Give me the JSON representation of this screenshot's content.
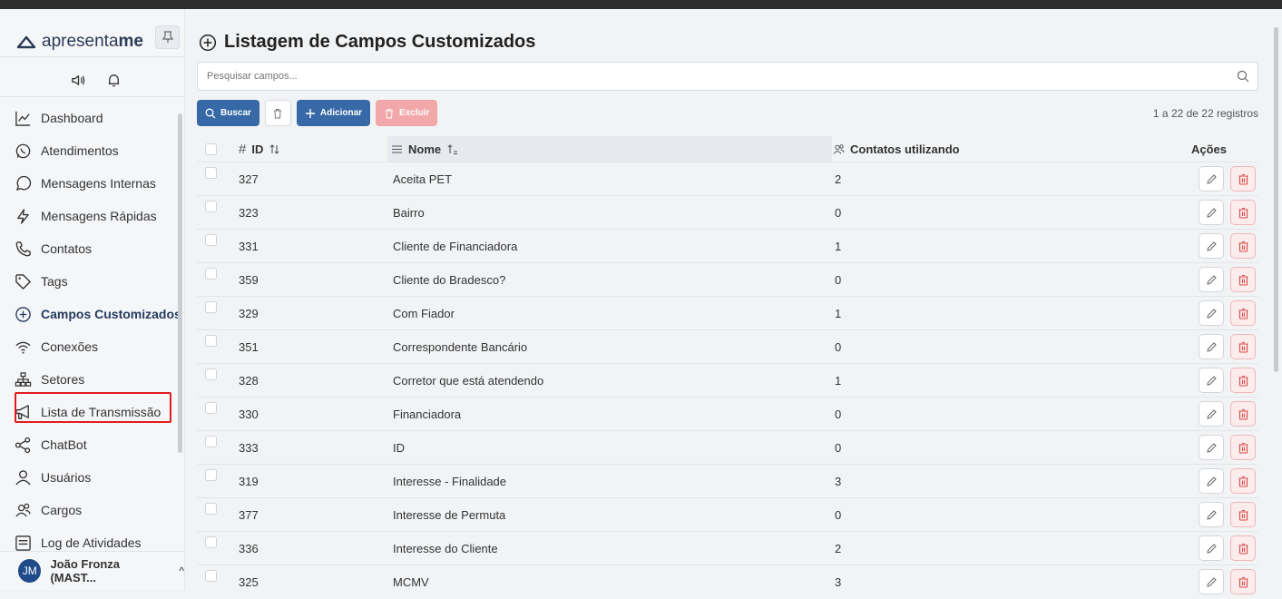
{
  "brand": {
    "name_light": "apresenta",
    "name_bold": "me"
  },
  "sidebar": {
    "items": [
      {
        "label": "Dashboard",
        "icon": "chart-line-icon"
      },
      {
        "label": "Atendimentos",
        "icon": "whatsapp-icon"
      },
      {
        "label": "Mensagens Internas",
        "icon": "chat-bubble-icon"
      },
      {
        "label": "Mensagens Rápidas",
        "icon": "lightning-icon"
      },
      {
        "label": "Contatos",
        "icon": "phone-icon"
      },
      {
        "label": "Tags",
        "icon": "tag-icon"
      },
      {
        "label": "Campos Customizados",
        "icon": "plus-circle-icon",
        "active": true
      },
      {
        "label": "Conexões",
        "icon": "wifi-icon"
      },
      {
        "label": "Setores",
        "icon": "sitemap-icon"
      },
      {
        "label": "Lista de Transmissão",
        "icon": "megaphone-icon"
      },
      {
        "label": "ChatBot",
        "icon": "share-nodes-icon"
      },
      {
        "label": "Usuários",
        "icon": "user-icon"
      },
      {
        "label": "Cargos",
        "icon": "users-icon"
      },
      {
        "label": "Log de Atividades",
        "icon": "list-box-icon"
      }
    ]
  },
  "user": {
    "initials": "JM",
    "name": "João Fronza (MAST...",
    "chevron": "^"
  },
  "page": {
    "title": "Listagem de Campos Customizados",
    "search_placeholder": "Pesquisar campos...",
    "buttons": {
      "search": "Buscar",
      "add": "Adicionar",
      "delete": "Excluir"
    },
    "record_count": "1 a 22 de 22 registros"
  },
  "table": {
    "headers": {
      "hash": "#",
      "id": "ID",
      "name": "Nome",
      "contacts": "Contatos utilizando",
      "actions": "Ações"
    },
    "rows": [
      {
        "id": "327",
        "name": "Aceita PET",
        "contacts": "2"
      },
      {
        "id": "323",
        "name": "Bairro",
        "contacts": "0"
      },
      {
        "id": "331",
        "name": "Cliente de Financiadora",
        "contacts": "1"
      },
      {
        "id": "359",
        "name": "Cliente do Bradesco?",
        "contacts": "0"
      },
      {
        "id": "329",
        "name": "Com Fiador",
        "contacts": "1"
      },
      {
        "id": "351",
        "name": "Correspondente Bancário",
        "contacts": "0"
      },
      {
        "id": "328",
        "name": "Corretor que está atendendo",
        "contacts": "1"
      },
      {
        "id": "330",
        "name": "Financiadora",
        "contacts": "0"
      },
      {
        "id": "333",
        "name": "ID",
        "contacts": "0"
      },
      {
        "id": "319",
        "name": "Interesse - Finalidade",
        "contacts": "3"
      },
      {
        "id": "377",
        "name": "Interesse de Permuta",
        "contacts": "0"
      },
      {
        "id": "336",
        "name": "Interesse do Cliente",
        "contacts": "2"
      },
      {
        "id": "325",
        "name": "MCMV",
        "contacts": "3"
      }
    ]
  },
  "colors": {
    "primary": "#3669a5",
    "danger_soft": "#f2a8a8",
    "active_outline": "#e01d1d"
  }
}
